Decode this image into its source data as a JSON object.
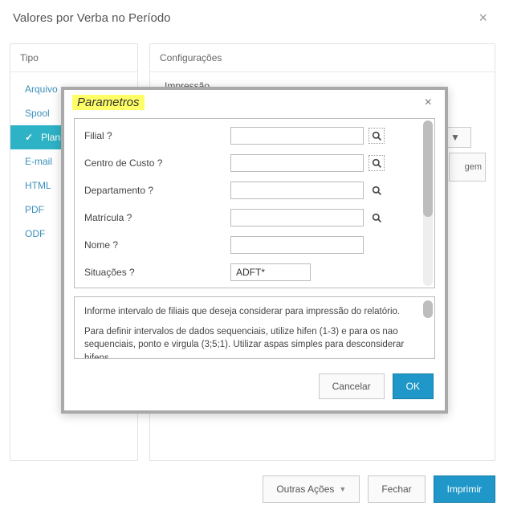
{
  "header": {
    "title": "Valores por Verba no Período",
    "close": "×"
  },
  "panels": {
    "left_title": "Tipo",
    "right_title": "Configurações",
    "right_section": "Impressão",
    "right_stub": "gem",
    "types": [
      {
        "label": "Arquivo",
        "active": false
      },
      {
        "label": "Spool",
        "active": false
      },
      {
        "label": "Planilha",
        "active": true
      },
      {
        "label": "E-mail",
        "active": false
      },
      {
        "label": "HTML",
        "active": false
      },
      {
        "label": "PDF",
        "active": false
      },
      {
        "label": "ODF",
        "active": false
      }
    ]
  },
  "modal": {
    "title": "Parametros",
    "close": "×",
    "fields": [
      {
        "label": "Filial ?",
        "value": "",
        "lookup": true,
        "lookup_boxed": true
      },
      {
        "label": "Centro de Custo ?",
        "value": "",
        "lookup": true,
        "lookup_boxed": true
      },
      {
        "label": "Departamento ?",
        "value": "",
        "lookup": true,
        "lookup_boxed": false
      },
      {
        "label": "Matrícula ?",
        "value": "",
        "lookup": true,
        "lookup_boxed": false
      },
      {
        "label": "Nome ?",
        "value": "",
        "lookup": false
      },
      {
        "label": "Situações ?",
        "value": "ADFT*",
        "lookup": false,
        "short": true
      }
    ],
    "help_line1": "Informe intervalo de filiais que deseja considerar para impressão do relatório.",
    "help_line2": "Para definir intervalos de dados sequenciais, utilize hifen (1-3) e para os nao sequenciais, ponto e virgula (3;5;1). Utilizar aspas simples para desconsiderar hifens",
    "cancel": "Cancelar",
    "ok": "OK"
  },
  "actions": {
    "other": "Outras Ações",
    "close": "Fechar",
    "print": "Imprimir"
  },
  "dropdown_caret": "▼"
}
